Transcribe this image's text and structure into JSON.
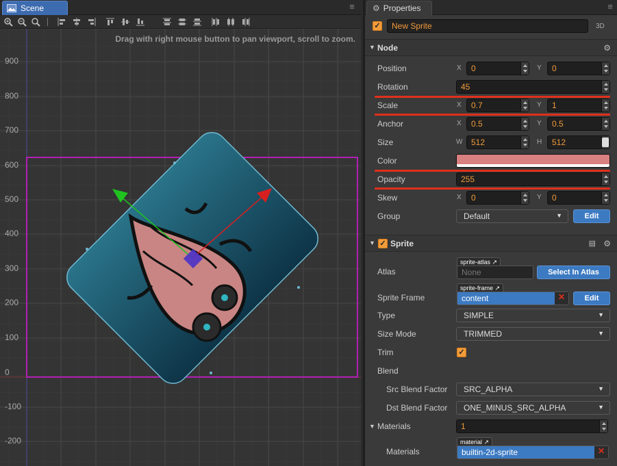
{
  "scene": {
    "tab_label": "Scene",
    "hint": "Drag with right mouse button to pan viewport, scroll to zoom.",
    "y_labels": [
      "900",
      "800",
      "700",
      "600",
      "500",
      "400",
      "300",
      "200",
      "100",
      "0",
      "-100",
      "-200"
    ],
    "toolbar_icons": [
      "zoom-in-icon",
      "zoom-out-icon",
      "zoom-reset-icon",
      "align-left-icon",
      "align-center-h-icon",
      "align-right-icon",
      "align-top-icon",
      "align-center-v-icon",
      "align-bottom-icon",
      "distribute-top-icon",
      "distribute-middle-icon",
      "distribute-bottom-icon",
      "distribute-left-icon",
      "distribute-center-icon",
      "distribute-right-icon"
    ]
  },
  "properties": {
    "tab_label": "Properties",
    "node_name": "New Sprite",
    "mode_3d": "3D",
    "node_section": "Node",
    "position": {
      "label": "Position",
      "x_axis": "X",
      "x": "0",
      "y_axis": "Y",
      "y": "0"
    },
    "rotation": {
      "label": "Rotation",
      "value": "45"
    },
    "scale": {
      "label": "Scale",
      "x_axis": "X",
      "x": "0.7",
      "y_axis": "Y",
      "y": "1"
    },
    "anchor": {
      "label": "Anchor",
      "x_axis": "X",
      "x": "0.5",
      "y_axis": "Y",
      "y": "0.5"
    },
    "size": {
      "label": "Size",
      "w_axis": "W",
      "w": "512",
      "h_axis": "H",
      "h": "512"
    },
    "color": {
      "label": "Color",
      "value": "#d98080"
    },
    "opacity": {
      "label": "Opacity",
      "value": "255"
    },
    "skew": {
      "label": "Skew",
      "x_axis": "X",
      "x": "0",
      "y_axis": "Y",
      "y": "0"
    },
    "group": {
      "label": "Group",
      "value": "Default",
      "edit": "Edit"
    },
    "sprite_section": "Sprite",
    "atlas": {
      "label": "Atlas",
      "tag": "sprite-atlas",
      "value": "None",
      "button": "Select In Atlas"
    },
    "sprite_frame": {
      "label": "Sprite Frame",
      "tag": "sprite-frame",
      "value": "content",
      "edit": "Edit"
    },
    "type": {
      "label": "Type",
      "value": "SIMPLE"
    },
    "size_mode": {
      "label": "Size Mode",
      "value": "TRIMMED"
    },
    "trim": {
      "label": "Trim"
    },
    "blend": {
      "label": "Blend"
    },
    "src_blend": {
      "label": "Src Blend Factor",
      "value": "SRC_ALPHA"
    },
    "dst_blend": {
      "label": "Dst Blend Factor",
      "value": "ONE_MINUS_SRC_ALPHA"
    },
    "materials_count": {
      "label": "Materials",
      "value": "1"
    },
    "materials": {
      "label": "Materials",
      "tag": "material",
      "value": "builtin-2d-sprite"
    }
  },
  "colors": {
    "accent_orange": "#f29b3a",
    "selection_blue": "#3c7ac2",
    "highlight_red": "#e0301c",
    "bounds_magenta": "#b21fb5"
  }
}
